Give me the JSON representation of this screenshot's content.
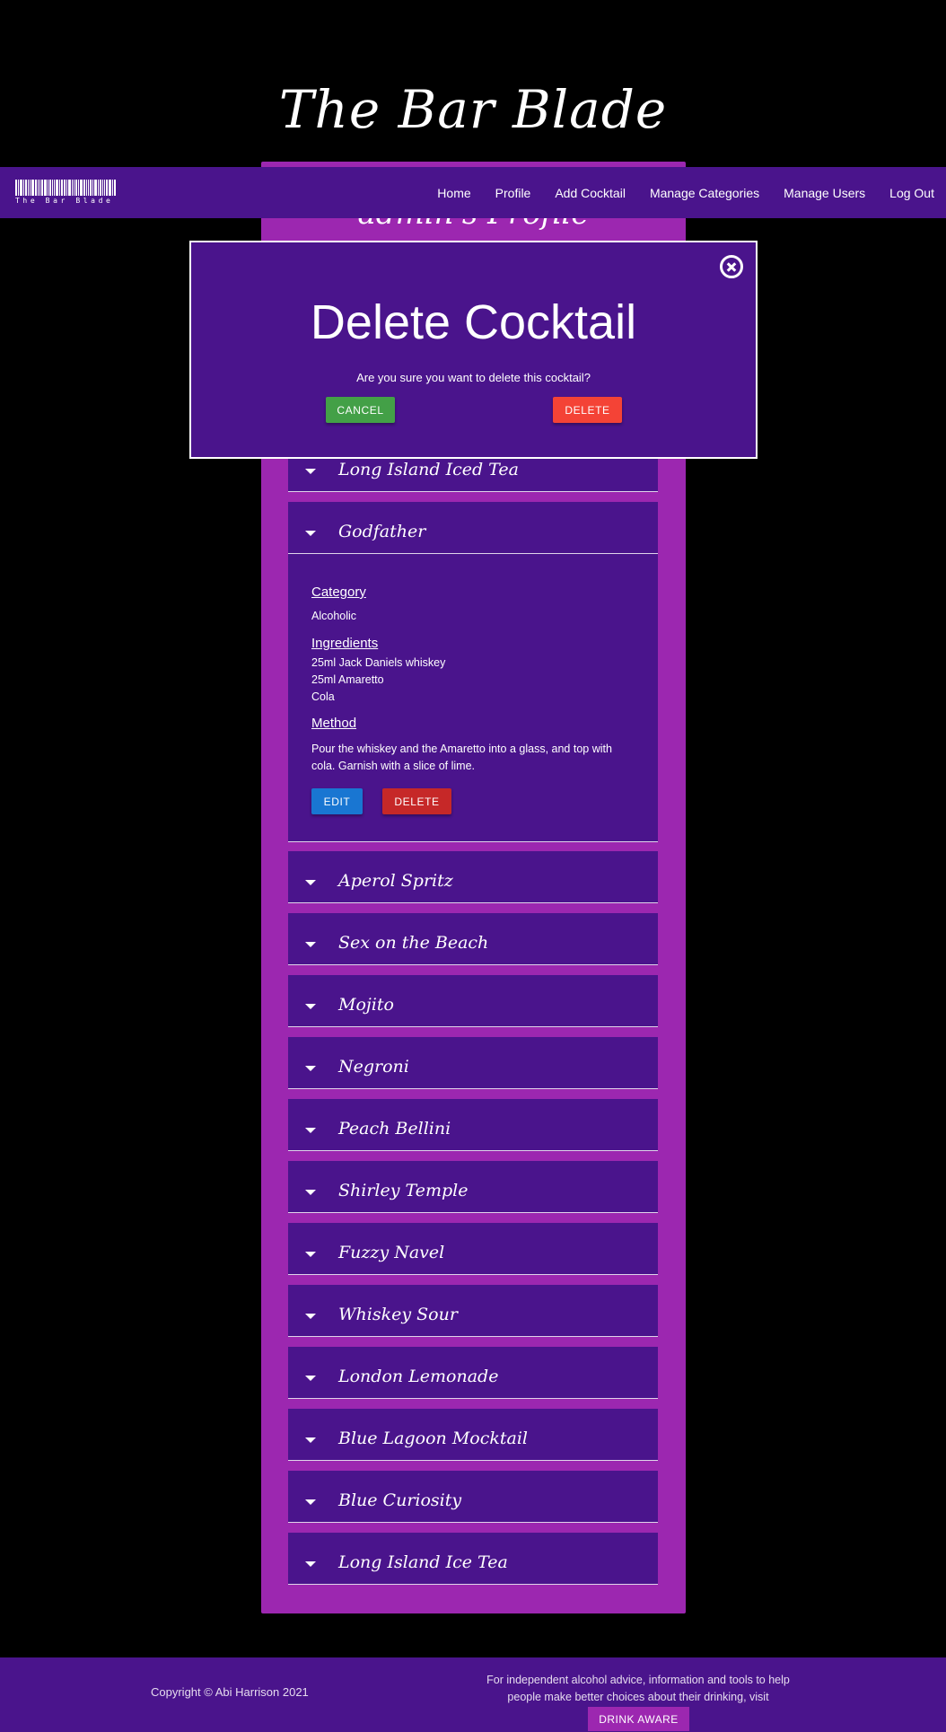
{
  "site": {
    "title": "The Bar Blade",
    "logo_text": "The Bar Blade"
  },
  "nav": {
    "items": [
      {
        "label": "Home"
      },
      {
        "label": "Profile"
      },
      {
        "label": "Add Cocktail"
      },
      {
        "label": "Manage Categories"
      },
      {
        "label": "Manage Users"
      },
      {
        "label": "Log Out"
      }
    ]
  },
  "profile": {
    "title": "admin's Profile"
  },
  "cocktails": {
    "first": "Long Island Iced Tea",
    "expanded": {
      "name": "Godfather",
      "category_label": "Category",
      "category": "Alcoholic",
      "ingredients_label": "Ingredients",
      "ingredients": [
        "25ml Jack Daniels whiskey",
        "25ml Amaretto",
        "Cola"
      ],
      "method_label": "Method",
      "method": "Pour the whiskey and the Amaretto into a glass, and top with cola. Garnish with a slice of lime.",
      "edit_label": "EDIT",
      "delete_label": "DELETE"
    },
    "collapsed": [
      "Aperol Spritz",
      "Sex on the Beach",
      "Mojito",
      "Negroni",
      "Peach Bellini",
      "Shirley Temple",
      "Fuzzy Navel",
      "Whiskey Sour",
      "London Lemonade",
      "Blue Lagoon Mocktail",
      "Blue Curiosity",
      "Long Island Ice Tea"
    ]
  },
  "modal": {
    "title": "Delete Cocktail",
    "text": "Are you sure you want to delete this cocktail?",
    "cancel_label": "CANCEL",
    "delete_label": "DELETE",
    "close_icon": "close-circle-icon"
  },
  "footer": {
    "copyright": "Copyright © Abi Harrison 2021",
    "advice": "For independent alcohol advice, information and tools to help people make better choices about their drinking, visit",
    "drink_aware_label": "DRINK AWARE"
  },
  "colors": {
    "primary": "#4a148c",
    "accent": "#9c27b0",
    "cancel": "#43a047",
    "danger": "#f44336",
    "edit": "#1976d2"
  }
}
